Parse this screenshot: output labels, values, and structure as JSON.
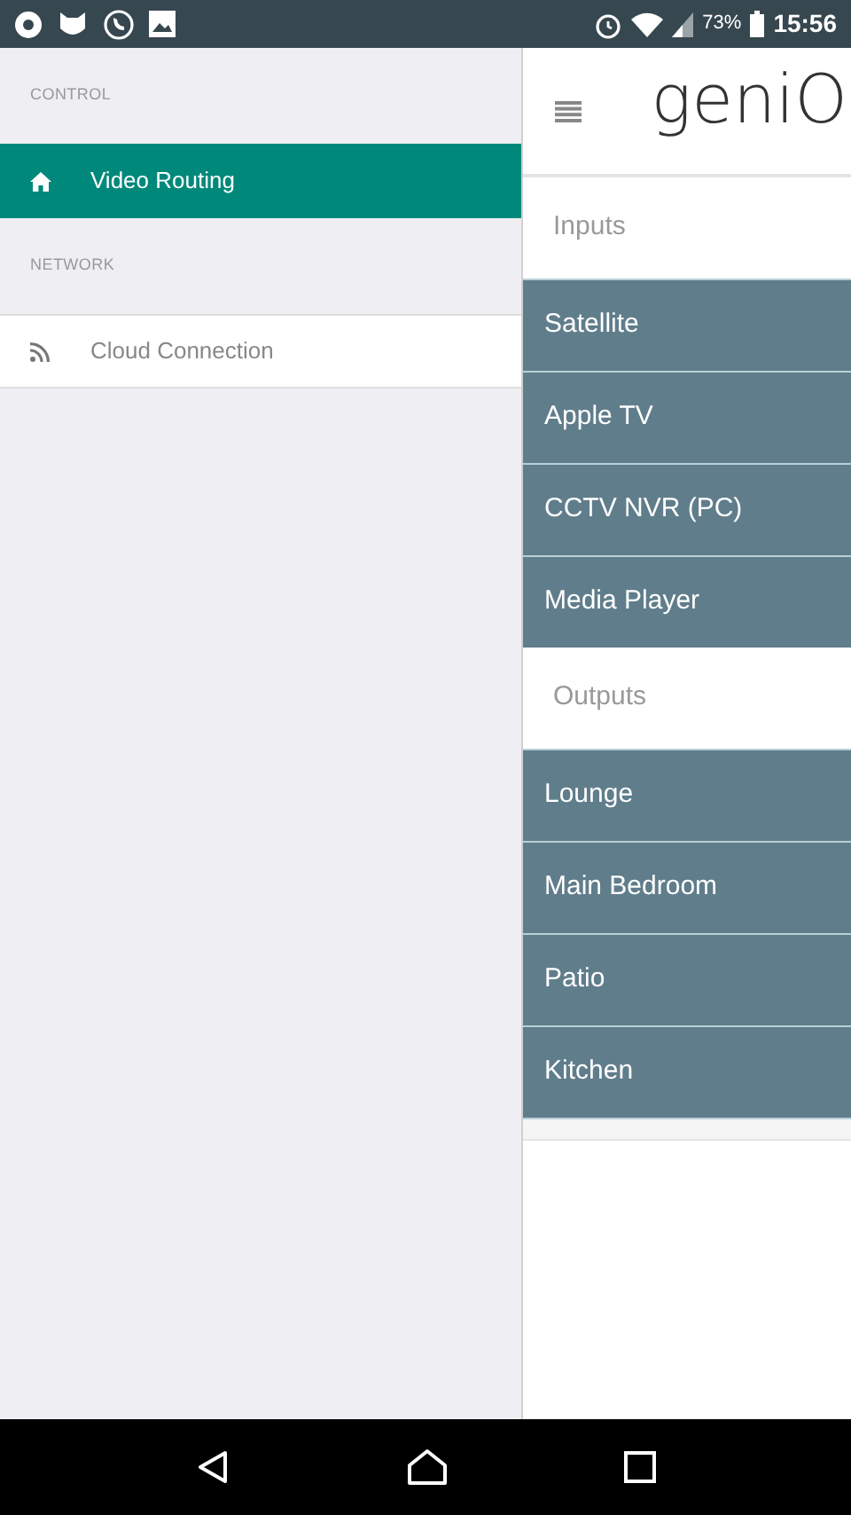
{
  "status_bar": {
    "battery": "73%",
    "time": "15:56"
  },
  "drawer": {
    "sections": [
      {
        "heading": "CONTROL",
        "items": [
          {
            "label": "Video Routing",
            "kind": "home",
            "selected": true
          }
        ]
      },
      {
        "heading": "NETWORK",
        "items": [
          {
            "label": "Cloud Connection",
            "kind": "feed",
            "selected": false
          }
        ]
      }
    ]
  },
  "header": {
    "logo": "geniO"
  },
  "panel": {
    "groups": [
      {
        "heading": "Inputs",
        "items": [
          "Satellite",
          "Apple TV",
          "CCTV NVR (PC)",
          "Media Player"
        ]
      },
      {
        "heading": "Outputs",
        "items": [
          "Lounge",
          "Main Bedroom",
          "Patio",
          "Kitchen"
        ]
      }
    ]
  }
}
